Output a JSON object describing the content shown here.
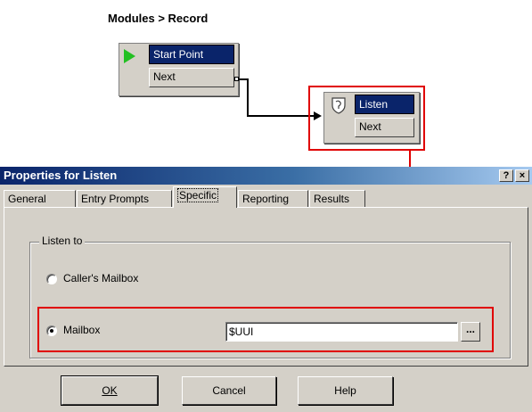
{
  "breadcrumb": "Modules > Record",
  "flow": {
    "start_node": {
      "title": "Start Point",
      "port": "Next",
      "icon": "play-icon"
    },
    "listen_node": {
      "title": "Listen",
      "port": "Next",
      "icon": "listen-shield-icon"
    }
  },
  "dialog": {
    "title": "Properties for Listen",
    "help_button": "?",
    "close_button": "×",
    "tabs": [
      {
        "label": "General",
        "active": false
      },
      {
        "label": "Entry Prompts",
        "active": false
      },
      {
        "label": "Specific",
        "active": true
      },
      {
        "label": "Reporting",
        "active": false
      },
      {
        "label": "Results",
        "active": false
      }
    ],
    "group": {
      "legend": "Listen to",
      "options": [
        {
          "label": "Caller's Mailbox",
          "selected": false
        },
        {
          "label": "Mailbox",
          "selected": true
        }
      ],
      "mailbox_value": "$UUI",
      "browse_label": "..."
    },
    "buttons": {
      "ok": "OK",
      "cancel": "Cancel",
      "help": "Help"
    }
  },
  "colors": {
    "highlight": "#e00000",
    "titlebar": "#0a246a",
    "face": "#d4d0c8"
  }
}
